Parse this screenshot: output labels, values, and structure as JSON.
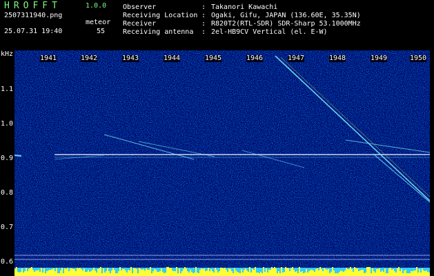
{
  "header": {
    "app_title": "HROFFT",
    "app_version": "1.0.0",
    "filename": "2507311940.png",
    "date_time": "25.07.31 19:40",
    "mode_label": "meteor",
    "count": "55",
    "info": [
      {
        "label": "Observer",
        "value": "Takanori Kawachi"
      },
      {
        "label": "Receiving Location",
        "value": "Ogaki, Gifu, JAPAN (136.60E, 35.35N)"
      },
      {
        "label": "Receiver",
        "value": "R820T2(RTL-SDR) SDR-Sharp 53.1000MHz"
      },
      {
        "label": "Receiving antenna",
        "value": "2el-HB9CV Vertical (el. E-W)"
      }
    ]
  },
  "axes": {
    "y_unit": "kHz",
    "y_ticks": [
      "1.1",
      "1.0",
      "0.9",
      "0.8",
      "0.7",
      "0.6"
    ],
    "x_ticks": [
      "1941",
      "1942",
      "1943",
      "1944",
      "1945",
      "1946",
      "1947",
      "1948",
      "1949",
      "1950"
    ]
  },
  "colors": {
    "background_noise": "#000a6e",
    "signal": "#e8e8ff",
    "meteor_echo": "#7cf0ff",
    "hot_pixel": "#ffff33",
    "title_green": "#7cfc7c",
    "bottom_band_cyan": "#33ccff",
    "bottom_band_yellow": "#ffff33"
  }
}
